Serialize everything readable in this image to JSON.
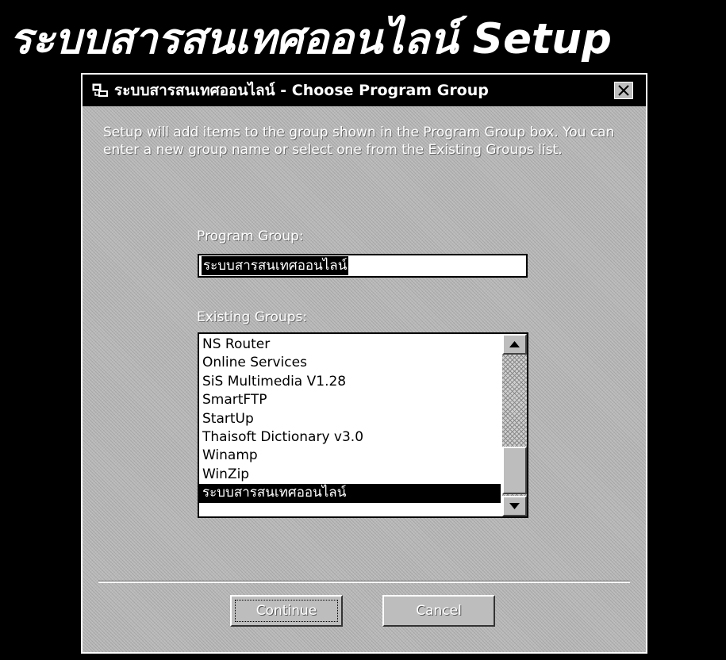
{
  "banner": {
    "title": "ระบบสารสนเทศออนไลน์ Setup"
  },
  "dialog": {
    "title": "ระบบสารสนเทศออนไลน์ - Choose Program Group",
    "intro": "Setup will add items to the group shown in the Program Group box. You can enter a new group name or select one from the Existing Groups list.",
    "program_group_label": "Program Group:",
    "program_group_value": "ระบบสารสนเทศออนไลน์",
    "existing_groups_label": "Existing Groups:",
    "existing_groups": [
      "NS Router",
      "Online Services",
      "SiS Multimedia V1.28",
      "SmartFTP",
      "StartUp",
      "Thaisoft Dictionary v3.0",
      "Winamp",
      "WinZip",
      "ระบบสารสนเทศออนไลน์"
    ],
    "selected_group_index": 8,
    "continue_label": "Continue",
    "cancel_label": "Cancel"
  },
  "icons": {
    "titlebar": "setup-app-icon",
    "close": "close-icon",
    "scroll_up": "arrow-up-icon",
    "scroll_down": "arrow-down-icon"
  }
}
